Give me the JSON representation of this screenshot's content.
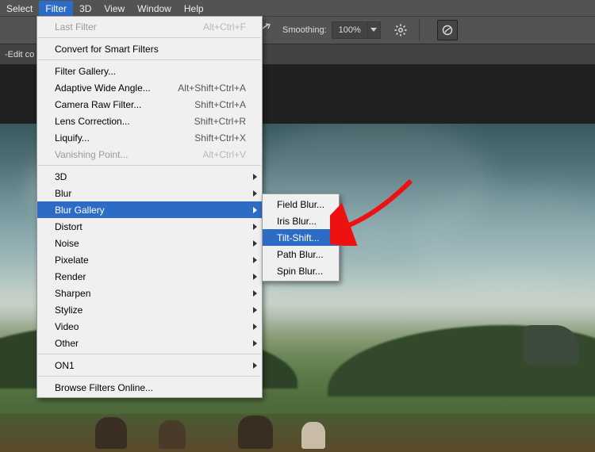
{
  "menubar": {
    "items": [
      "Select",
      "Filter",
      "3D",
      "View",
      "Window",
      "Help"
    ],
    "open_index": 1
  },
  "optionsbar": {
    "smoothing_label": "Smoothing:",
    "smoothing_value": "100%"
  },
  "tabbar": {
    "fragment": "-Edit co"
  },
  "filter_menu": {
    "groups": [
      [
        {
          "label": "Last Filter",
          "shortcut": "Alt+Ctrl+F",
          "disabled": true
        }
      ],
      [
        {
          "label": "Convert for Smart Filters"
        }
      ],
      [
        {
          "label": "Filter Gallery..."
        },
        {
          "label": "Adaptive Wide Angle...",
          "shortcut": "Alt+Shift+Ctrl+A"
        },
        {
          "label": "Camera Raw Filter...",
          "shortcut": "Shift+Ctrl+A"
        },
        {
          "label": "Lens Correction...",
          "shortcut": "Shift+Ctrl+R"
        },
        {
          "label": "Liquify...",
          "shortcut": "Shift+Ctrl+X"
        },
        {
          "label": "Vanishing Point...",
          "shortcut": "Alt+Ctrl+V",
          "disabled": true
        }
      ],
      [
        {
          "label": "3D",
          "submenu": true
        },
        {
          "label": "Blur",
          "submenu": true
        },
        {
          "label": "Blur Gallery",
          "submenu": true,
          "highlight": true
        },
        {
          "label": "Distort",
          "submenu": true
        },
        {
          "label": "Noise",
          "submenu": true
        },
        {
          "label": "Pixelate",
          "submenu": true
        },
        {
          "label": "Render",
          "submenu": true
        },
        {
          "label": "Sharpen",
          "submenu": true
        },
        {
          "label": "Stylize",
          "submenu": true
        },
        {
          "label": "Video",
          "submenu": true
        },
        {
          "label": "Other",
          "submenu": true
        }
      ],
      [
        {
          "label": "ON1",
          "submenu": true
        }
      ],
      [
        {
          "label": "Browse Filters Online..."
        }
      ]
    ]
  },
  "blur_gallery_submenu": {
    "items": [
      {
        "label": "Field Blur..."
      },
      {
        "label": "Iris Blur..."
      },
      {
        "label": "Tilt-Shift...",
        "highlight": true
      },
      {
        "label": "Path Blur..."
      },
      {
        "label": "Spin Blur..."
      }
    ]
  }
}
